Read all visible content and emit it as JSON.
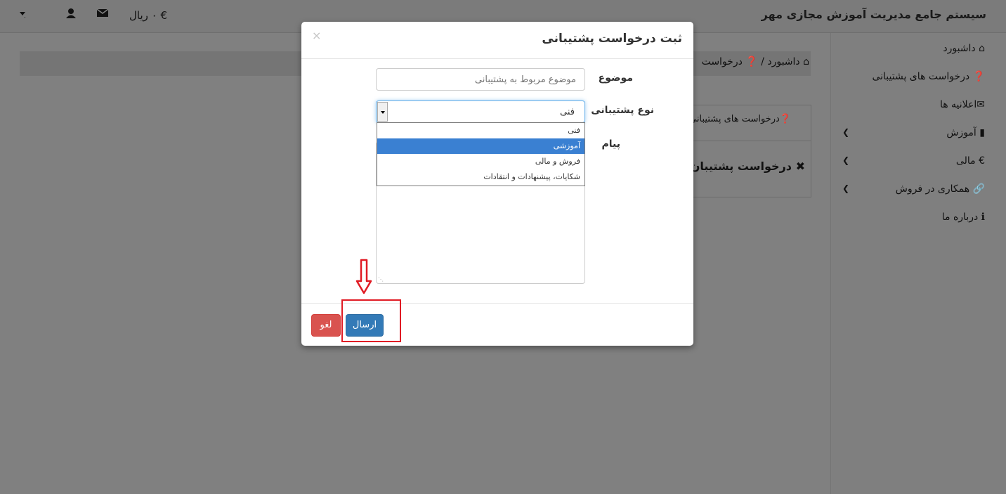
{
  "app": {
    "title": "سیستم جامع مدیریت آموزش مجازی مهر"
  },
  "topbar": {
    "balance": "€ ۰ ریال",
    "icons": [
      "caret-down-icon",
      "user-icon",
      "envelope-icon",
      "euro-icon"
    ]
  },
  "sidebar": {
    "items": [
      {
        "label": "داشبورد",
        "icon": "home-icon",
        "expandable": false
      },
      {
        "label": "درخواست های پشتیبانی",
        "icon": "question-circle-icon",
        "expandable": false
      },
      {
        "label": "اعلانیه ها",
        "icon": "envelope-icon",
        "expandable": false
      },
      {
        "label": "آموزش",
        "icon": "book-icon",
        "expandable": true
      },
      {
        "label": "مالی",
        "icon": "euro-icon",
        "expandable": true
      },
      {
        "label": "همکاری در فروش",
        "icon": "link-icon",
        "expandable": true
      },
      {
        "label": "درباره ما",
        "icon": "info-circle-icon",
        "expandable": false
      }
    ]
  },
  "breadcrumb": {
    "home": "داشبورد",
    "current": "درخواست"
  },
  "panel": {
    "heading": "درخواست های پشتیبانی مر",
    "title": "درخواست پشتیبان"
  },
  "modal": {
    "title": "ثبت درخواست پشتیبانی",
    "close": "×",
    "subject_label": "موضوع",
    "subject_placeholder": "موضوع مربوط به پشتیبانی",
    "type_label": "نوع پشتیبانی",
    "type_value": "فنی",
    "type_options": [
      "فنی",
      "آموزشی",
      "فروش و مالی",
      "شکایات، پیشنهادات و انتقادات"
    ],
    "type_highlighted": "آموزشی",
    "message_label": "پیام",
    "send_label": "ارسال",
    "cancel_label": "لغو"
  },
  "colors": {
    "overlay": "#808080",
    "primary": "#337ab7",
    "danger": "#d9534f",
    "highlight": "#e01b24",
    "option_selected": "#3a80d2"
  }
}
